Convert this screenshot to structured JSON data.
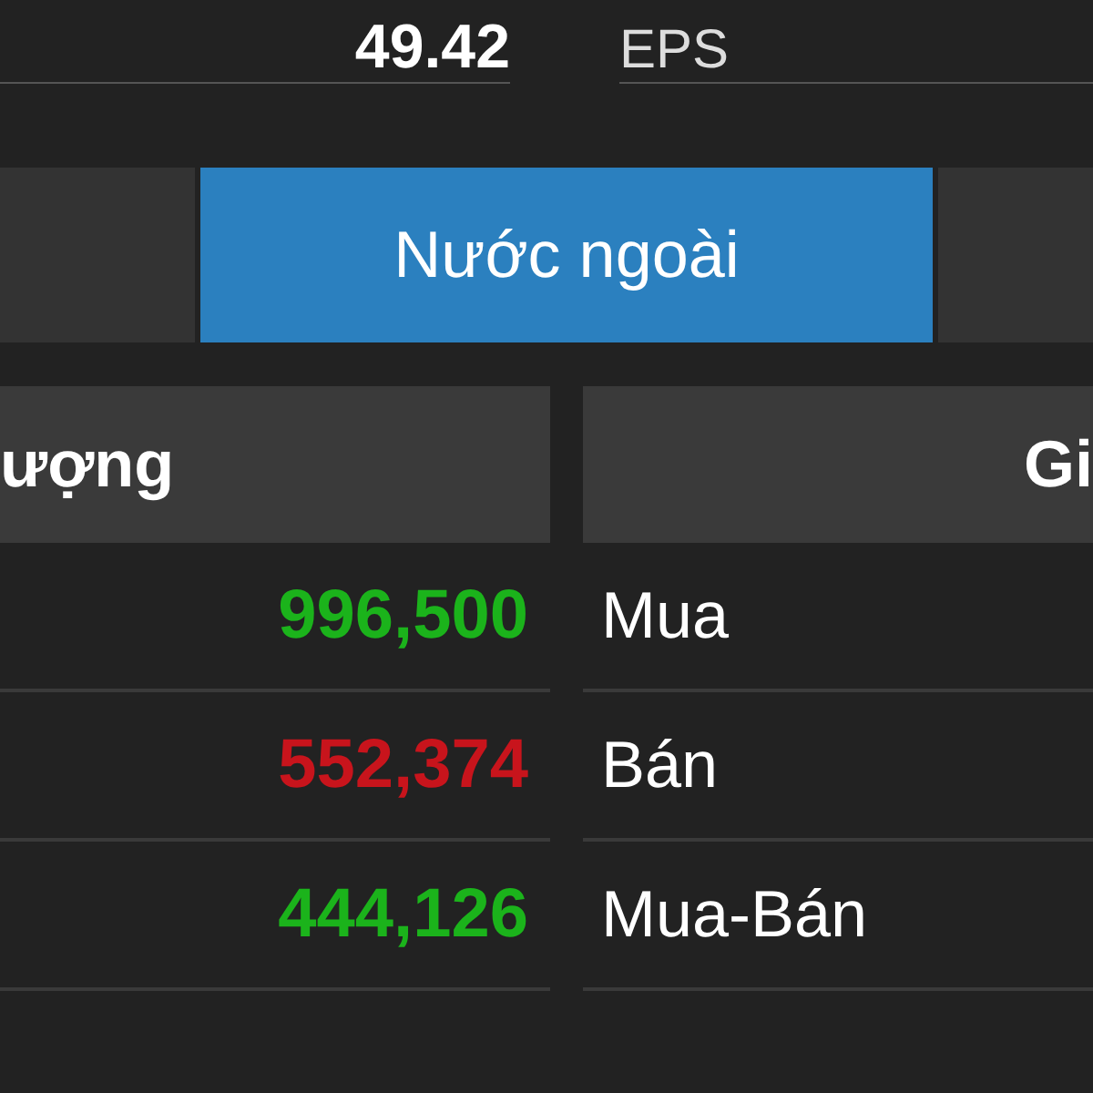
{
  "summary": [
    {
      "value": "49.42"
    },
    {
      "label": "EPS"
    }
  ],
  "tabs": [
    {
      "selected": false
    },
    {
      "label": "Nước ngoài",
      "selected": true
    },
    {
      "selected": false
    }
  ],
  "table": {
    "columns": [
      "ượng",
      "Gi"
    ],
    "rows": [
      {
        "value": "996,500",
        "color": "#1bb31b",
        "label": "Mua"
      },
      {
        "value": "552,374",
        "color": "#c8141c",
        "label": "Bán"
      },
      {
        "value": "444,126",
        "color": "#1bb31b",
        "label": "Mua-Bán"
      }
    ]
  }
}
